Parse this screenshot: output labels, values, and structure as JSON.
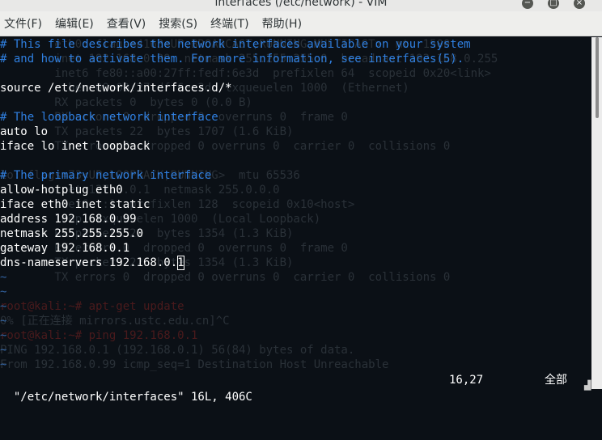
{
  "window": {
    "title": "interfaces (/etc/network) - VIM",
    "minimize_glyph": "−",
    "maximize_glyph": "□",
    "close_glyph": "×"
  },
  "menu": [
    "文件(F)",
    "编辑(E)",
    "查看(V)",
    "搜索(S)",
    "终端(T)",
    "帮助(H)"
  ],
  "background_lines": [
    {
      "text": "        eth0: flags=4163<UP,BROADCAST,RUNNING,MULTICAST>  mtu 1500",
      "cls": ""
    },
    {
      "text": "        inet 192.168.0.99  netmask 255.255.255.0  broadcast 192.168.0.255",
      "cls": ""
    },
    {
      "text": "        inet6 fe80::a00:27ff:fedf:6e3d  prefixlen 64  scopeid 0x20<link>",
      "cls": ""
    },
    {
      "text": "        ether 08:00:27:df:6e:3d  txqueuelen 1000  (Ethernet)",
      "cls": ""
    },
    {
      "text": "        RX packets 0  bytes 0 (0.0 B)",
      "cls": ""
    },
    {
      "text": "        RX errors 0  dropped 0  overruns 0  frame 0",
      "cls": ""
    },
    {
      "text": "        TX packets 22  bytes 1707 (1.6 KiB)",
      "cls": ""
    },
    {
      "text": "        TX errors 0  dropped 0 overruns 0  carrier 0  collisions 0",
      "cls": ""
    },
    {
      "text": "",
      "cls": ""
    },
    {
      "text": "lo: flags=73<UP,LOOPBACK,RUNNING>  mtu 65536",
      "cls": ""
    },
    {
      "text": "        inet 127.0.0.1  netmask 255.0.0.0",
      "cls": ""
    },
    {
      "text": "        inet6 ::1  prefixlen 128  scopeid 0x10<host>",
      "cls": ""
    },
    {
      "text": "        loop  txqueuelen 1000  (Local Loopback)",
      "cls": ""
    },
    {
      "text": "        RX packets 22  bytes 1354 (1.3 KiB)",
      "cls": ""
    },
    {
      "text": "        RX errors 0  dropped 0  overruns 0  frame 0",
      "cls": ""
    },
    {
      "text": "        TX packets 22  bytes 1354 (1.3 KiB)",
      "cls": ""
    },
    {
      "text": "        TX errors 0  dropped 0 overruns 0  carrier 0  collisions 0",
      "cls": ""
    },
    {
      "text": "",
      "cls": ""
    },
    {
      "text": "root@kali:~# apt-get update",
      "cls": "r"
    },
    {
      "text": "0% [正在连接 mirrors.ustc.edu.cn]^C",
      "cls": ""
    },
    {
      "text": "root@kali:~# ping 192.168.0.1",
      "cls": "r"
    },
    {
      "text": "PING 192.168.0.1 (192.168.0.1) 56(84) bytes of data.",
      "cls": ""
    },
    {
      "text": "From 192.168.0.99 icmp_seq=1 Destination Host Unreachable",
      "cls": ""
    }
  ],
  "vim_lines": [
    {
      "text": "# This file describes the network interfaces available on your system",
      "type": "comment"
    },
    {
      "text": "# and how to activate them. For more information, see interfaces(5).",
      "type": "comment"
    },
    {
      "text": "",
      "type": "text"
    },
    {
      "text": "source /etc/network/interfaces.d/*",
      "type": "text"
    },
    {
      "text": "",
      "type": "text"
    },
    {
      "text": "# The loopback network interface",
      "type": "comment"
    },
    {
      "text": "auto lo",
      "type": "text"
    },
    {
      "text": "iface lo inet loopback",
      "type": "text"
    },
    {
      "text": "",
      "type": "text"
    },
    {
      "text": "# The primary network interface",
      "type": "comment"
    },
    {
      "text": "allow-hotplug eth0",
      "type": "text"
    },
    {
      "text": "iface eth0 inet static",
      "type": "text"
    },
    {
      "text": "address 192.168.0.99",
      "type": "text"
    },
    {
      "text": "netmask 255.255.255.0",
      "type": "text"
    },
    {
      "text": "gateway 192.168.0.1",
      "type": "text"
    },
    {
      "text": "dns-nameservers 192.168.0.1",
      "type": "text",
      "cursor_col": 26
    },
    {
      "text": "~",
      "type": "tilde"
    },
    {
      "text": "~",
      "type": "tilde"
    },
    {
      "text": "~",
      "type": "tilde"
    },
    {
      "text": "~",
      "type": "tilde"
    },
    {
      "text": "~",
      "type": "tilde"
    },
    {
      "text": "~",
      "type": "tilde"
    },
    {
      "text": "~",
      "type": "tilde"
    }
  ],
  "status": {
    "file_info": "\"/etc/network/interfaces\" 16L, 406C",
    "cursor_pos": "16,27",
    "scroll_pct": "全部"
  },
  "colors": {
    "background": "#0b1016",
    "comment": "#2f7fe0",
    "tilde": "#3465a4",
    "text": "#ffffff"
  }
}
